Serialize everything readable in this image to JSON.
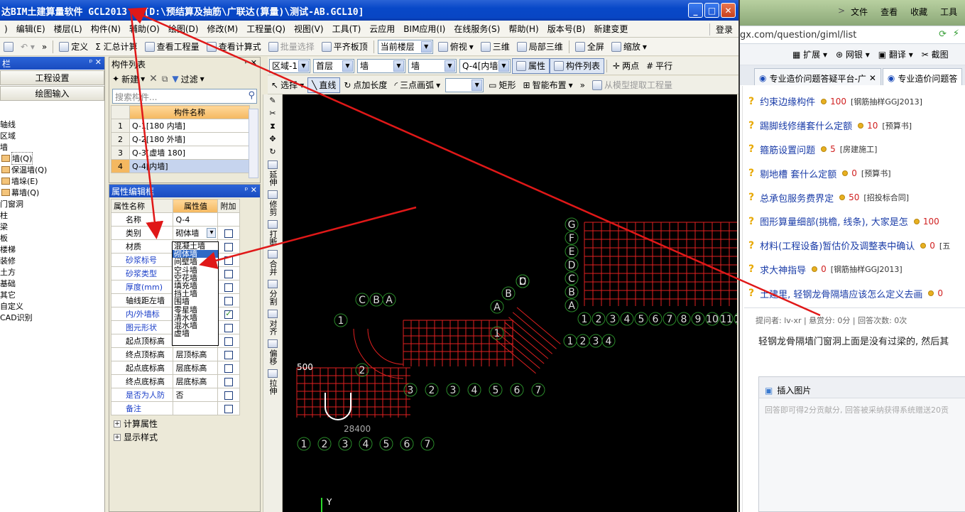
{
  "window": {
    "title": "达BIM土建算量软件 GCL2013 - [D:\\预结算及抽筋\\广联达(算量)\\测试-AB.GCL10]",
    "buttons": {
      "min": "_",
      "max": "□",
      "close": "✕"
    }
  },
  "menu": {
    "items": [
      ")",
      "编辑(E)",
      "楼层(L)",
      "构件(N)",
      "辅助(O)",
      "绘图(D)",
      "修改(M)",
      "工程量(Q)",
      "视图(V)",
      "工具(T)",
      "云应用",
      "BIM应用(I)",
      "在线服务(S)",
      "帮助(H)",
      "版本号(B)",
      "新建变更"
    ],
    "login": "登录"
  },
  "toolbar1": {
    "items": [
      "定义",
      "Σ 汇总计算",
      "查看工程量",
      "查看计算式",
      "批量选择",
      "平齐板顶"
    ],
    "floor_combo": "当前楼层",
    "view": "俯视",
    "three_d": "三维",
    "partial_3d": "局部三维",
    "fullscreen": "全屏",
    "zoom": "缩放"
  },
  "toolbar2": {
    "prop_panel_title": "构件列表",
    "region": "区域-1",
    "floor": "首层",
    "type1": "墙",
    "type2": "墙",
    "component": "Q-4[内墙",
    "attr_btn": "属性",
    "list_btn": "构件列表",
    "two_points": "两点",
    "parallel": "平行"
  },
  "toolbar3": {
    "select": "选择",
    "line": "直线",
    "point_len": "点加长度",
    "arc": "三点画弧",
    "rect": "矩形",
    "smart": "智能布置",
    "extract": "从模型提取工程量"
  },
  "leftcol": {
    "title": "栏",
    "btn_project": "工程设置",
    "btn_draw": "绘图输入",
    "tree": [
      "轴线",
      "区域",
      "墙",
      "墙(Q)",
      "保温墙(Q)",
      "墙垛(E)",
      "幕墙(Q)",
      "门窗洞",
      "柱",
      "梁",
      "板",
      "楼梯",
      "装修",
      "土方",
      "基础",
      "其它",
      "自定义",
      "CAD识别"
    ]
  },
  "complist": {
    "title": "构件列表",
    "new_btn": "新建",
    "filter_btn": "过滤",
    "search_placeholder": "搜索构件...",
    "col_header": "构件名称",
    "rows": [
      {
        "n": "1",
        "name": "Q-1[180 内墙]"
      },
      {
        "n": "2",
        "name": "Q-2[180 外墙]"
      },
      {
        "n": "3",
        "name": "Q-3[虚墙 180]"
      },
      {
        "n": "4",
        "name": "Q-4[内墙]"
      }
    ]
  },
  "propbox": {
    "title": "属性编辑框",
    "headers": [
      "属性名称",
      "属性值",
      "附加"
    ],
    "rows": [
      {
        "name": "名称",
        "value": "Q-4",
        "blue": false,
        "chk": null
      },
      {
        "name": "类别",
        "value": "砌体墙",
        "blue": false,
        "chk": false
      },
      {
        "name": "材质",
        "value": "",
        "blue": false,
        "chk": false
      },
      {
        "name": "砂浆标号",
        "value": "",
        "blue": true,
        "chk": false
      },
      {
        "name": "砂浆类型",
        "value": "",
        "blue": true,
        "chk": false
      },
      {
        "name": "厚度(mm)",
        "value": "",
        "blue": true,
        "chk": false
      },
      {
        "name": "轴线距左墙",
        "value": "",
        "blue": false,
        "chk": false
      },
      {
        "name": "内/外墙标",
        "value": "",
        "blue": true,
        "chk": true
      },
      {
        "name": "图元形状",
        "value": "",
        "blue": true,
        "chk": false
      },
      {
        "name": "起点顶标高",
        "value": "层顶标高",
        "blue": false,
        "chk": false
      },
      {
        "name": "终点顶标高",
        "value": "层顶标高",
        "blue": false,
        "chk": false
      },
      {
        "name": "起点底标高",
        "value": "层底标高",
        "blue": false,
        "chk": false
      },
      {
        "name": "终点底标高",
        "value": "层底标高",
        "blue": false,
        "chk": false
      },
      {
        "name": "是否为人防",
        "value": "否",
        "blue": true,
        "chk": false
      },
      {
        "name": "备注",
        "value": "",
        "blue": true,
        "chk": false
      }
    ],
    "expand1": "计算属性",
    "expand2": "显示样式"
  },
  "dropdown": {
    "options": [
      "混凝土墙",
      "砌体墙",
      "间壁墙",
      "空斗墙",
      "空花墙",
      "填充墙",
      "挡土墙",
      "围墙",
      "零星墙",
      "清水墙",
      "混水墙",
      "虚墙"
    ],
    "selected_index": 1
  },
  "vstrip": {
    "items": [
      "延伸",
      "修剪",
      "打断",
      "合并",
      "分割",
      "对齐",
      "偏移",
      "拉伸"
    ]
  },
  "canvas": {
    "dims": [
      "500",
      "28400"
    ],
    "axis_y": "Y",
    "grid_color": "#e02020",
    "axis_color": "#2a8a2a"
  },
  "browser": {
    "menu": [
      "文件",
      "查看",
      "收藏",
      "工具"
    ],
    "address": "gx.com/question/giml/list",
    "ext": [
      "扩展",
      "网银",
      "翻译",
      "截图"
    ],
    "tabs": [
      "专业造价问题答疑平台-广",
      "专业造价问题答"
    ],
    "questions": [
      {
        "title": "约束边缘构件",
        "pts": "100",
        "tag": "[钢筋抽样GGJ2013]"
      },
      {
        "title": "踢脚线修缮套什么定额",
        "pts": "10",
        "tag": "[预算书]"
      },
      {
        "title": "箍筋设置问题",
        "pts": "5",
        "tag": "[房建施工]"
      },
      {
        "title": "剔地槽 套什么定额",
        "pts": "0",
        "tag": "[预算书]"
      },
      {
        "title": "总承包服务费界定",
        "pts": "50",
        "tag": "[招投标合同]"
      },
      {
        "title": "图形算量细部(挑檐, 线条), 大家是怎",
        "pts": "100",
        "tag": ""
      },
      {
        "title": "材料(工程设备)暂估价及调整表中确认",
        "pts": "0",
        "tag": "[五"
      },
      {
        "title": "求大神指导",
        "pts": "0",
        "tag": "[钢筋抽样GGJ2013]"
      },
      {
        "title": "土建里, 轻钢龙骨隔墙应该怎么定义去画",
        "pts": "0",
        "tag": ""
      }
    ],
    "meta": "提问者: lv-xr  |  悬赏分: 0分  |  回答次数: 0次",
    "body": "轻钢龙骨隔墙门窗洞上面是没有过梁的, 然后其",
    "insert_image": "插入图片",
    "answer_placeholder": "回答即可得2分贡献分, 回答被采纳获得系统赠送20贡"
  },
  "colors": {
    "annotation_arrow": "#e01818",
    "title_blue": "#0848c8"
  }
}
